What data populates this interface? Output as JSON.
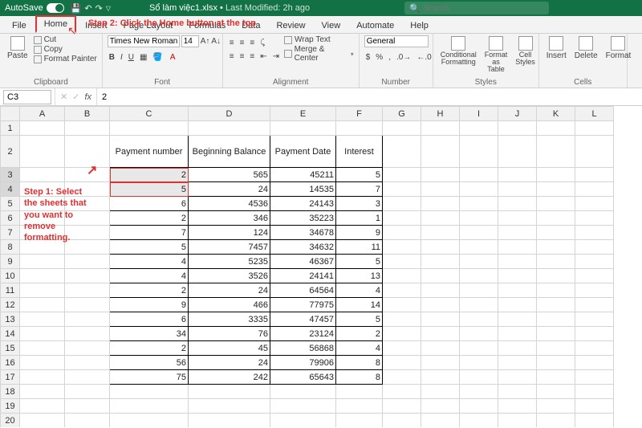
{
  "titlebar": {
    "autosave_label": "AutoSave",
    "autosave_state": "On",
    "doc_name": "Sổ làm việc1.xlsx",
    "last_modified": "Last Modified: 2h ago",
    "search_placeholder": "Search"
  },
  "menu": {
    "tabs": [
      "File",
      "Home",
      "Insert",
      "Page Layout",
      "Formulas",
      "Data",
      "Review",
      "View",
      "Automate",
      "Help"
    ],
    "active": "Home"
  },
  "annotations": {
    "step2": "Step 2: Click the Home button at the top",
    "step1": "Step 1: Select the sheets that you want to remove formatting."
  },
  "ribbon": {
    "clipboard": {
      "paste": "Paste",
      "cut": "Cut",
      "copy": "Copy",
      "format_painter": "Format Painter",
      "label": "Clipboard"
    },
    "font": {
      "name": "Times New Roman",
      "size": "14",
      "label": "Font"
    },
    "alignment": {
      "wrap": "Wrap Text",
      "merge": "Merge & Center",
      "label": "Alignment"
    },
    "number": {
      "format": "General",
      "label": "Number"
    },
    "styles": {
      "cond": "Conditional Formatting",
      "table": "Format as Table",
      "cell": "Cell Styles",
      "label": "Styles"
    },
    "cells": {
      "insert": "Insert",
      "delete": "Delete",
      "format": "Format",
      "label": "Cells"
    }
  },
  "formula_bar": {
    "cell_ref": "C3",
    "formula": "2"
  },
  "columns": [
    "A",
    "B",
    "C",
    "D",
    "E",
    "F",
    "G",
    "H",
    "I",
    "J",
    "K",
    "L"
  ],
  "rows": [
    "1",
    "2",
    "3",
    "4",
    "5",
    "6",
    "7",
    "8",
    "9",
    "10",
    "11",
    "12",
    "13",
    "14",
    "15",
    "16",
    "17",
    "18",
    "19",
    "20"
  ],
  "table": {
    "headers": [
      "Payment number",
      "Beginning Balance",
      "Payment Date",
      "Interest"
    ],
    "data": [
      [
        "2",
        "565",
        "45211",
        "5"
      ],
      [
        "5",
        "24",
        "14535",
        "7"
      ],
      [
        "6",
        "4536",
        "24143",
        "3"
      ],
      [
        "2",
        "346",
        "35223",
        "1"
      ],
      [
        "7",
        "124",
        "34678",
        "9"
      ],
      [
        "5",
        "7457",
        "34632",
        "11"
      ],
      [
        "4",
        "5235",
        "46367",
        "5"
      ],
      [
        "4",
        "3526",
        "24141",
        "13"
      ],
      [
        "2",
        "24",
        "64564",
        "4"
      ],
      [
        "9",
        "466",
        "77975",
        "14"
      ],
      [
        "6",
        "3335",
        "47457",
        "5"
      ],
      [
        "34",
        "76",
        "23124",
        "2"
      ],
      [
        "2",
        "45",
        "56868",
        "4"
      ],
      [
        "56",
        "24",
        "79906",
        "8"
      ],
      [
        "75",
        "242",
        "65643",
        "8"
      ]
    ]
  }
}
